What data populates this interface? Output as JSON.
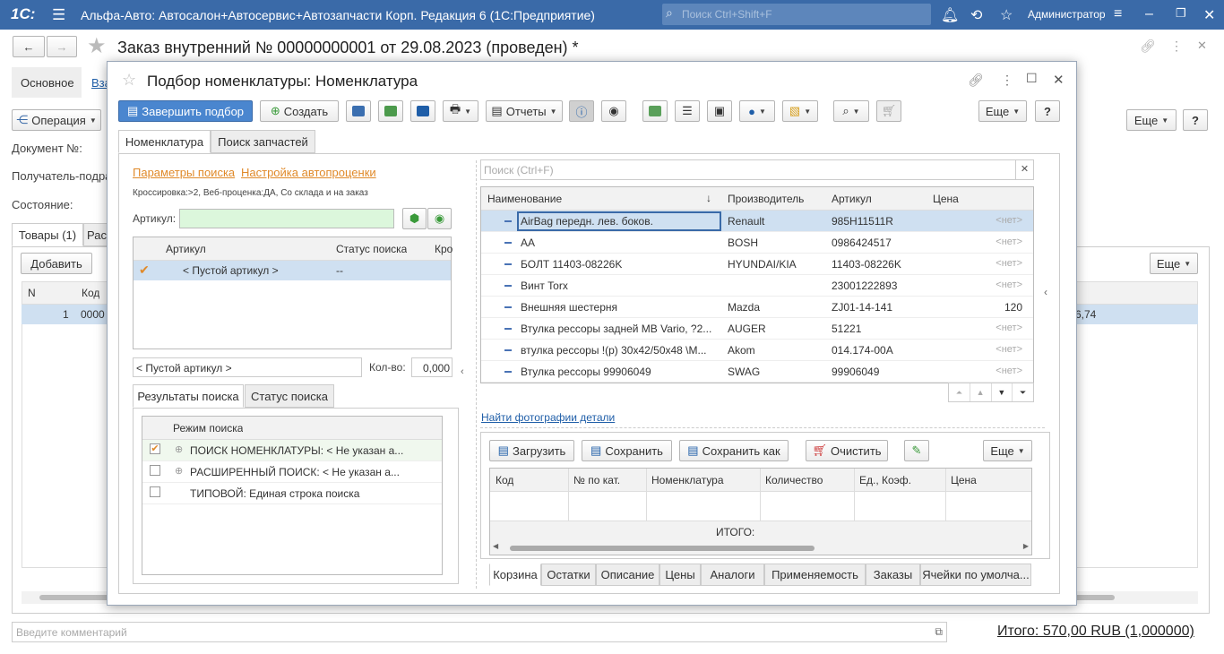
{
  "app": {
    "logo": "1С:",
    "title": "Альфа-Авто: Автосалон+Автосервис+Автозапчасти Корп. Редакция 6  (1С:Предприятие)",
    "search_placeholder": "Поиск Ctrl+Shift+F",
    "user": "Администратор",
    "icons": [
      "bell-icon",
      "history-icon",
      "star-icon",
      "settings-icon",
      "minimize-icon",
      "restore-icon",
      "close-icon"
    ]
  },
  "doc": {
    "title": "Заказ внутренний № 00000000001 от 29.08.2023 (проведен) *",
    "tab_main": "Основное",
    "tab_link": "Вза",
    "operation_btn": "Операция",
    "more_btn": "Еще",
    "help_btn": "?",
    "doc_no_label": "Документ №:",
    "recipient_label": "Получатель-подра",
    "state_label": "Состояние:",
    "goods_tab": "Товары (1)",
    "goods_tab2": "Рас",
    "add_btn": "Добавить",
    "col_n": "N",
    "col_code": "Код",
    "row_n": "1",
    "row_code": "0000",
    "row_tail": "6,74",
    "comment_placeholder": "Введите комментарий",
    "total": "Итого: 570,00 RUB (1,000000)"
  },
  "modal": {
    "title": "Подбор номенклатуры: Номенклатура",
    "finish_btn": "Завершить подбор",
    "create_btn": "Создать",
    "reports_btn": "Отчеты",
    "more_btn": "Еще",
    "help_btn": "?",
    "tab_nom": "Номенклатура",
    "tab_parts": "Поиск запчастей",
    "link_params": "Параметры поиска",
    "link_auto": "Настройка автопроценки",
    "cross_info": "Кроссировка:>2, Веб-проценка:ДА, Со склада и на заказ",
    "article_label": "Артикул:",
    "art_col": "Артикул",
    "status_col": "Статус поиска",
    "cross_col": "Кро",
    "empty_article": "< Пустой артикул >",
    "status_value": "--",
    "article_field": "< Пустой артикул >",
    "qty_label": "Кол-во:",
    "qty_value": "0,000",
    "tab_results": "Результаты поиска",
    "tab_status": "Статус поиска",
    "mode_col": "Режим поиска",
    "modes": [
      {
        "text": "ПОИСК НОМЕНКЛАТУРЫ: < Не указан а...",
        "checked": true
      },
      {
        "text": "РАСШИРЕННЫЙ ПОИСК: < Не указан а...",
        "checked": false
      },
      {
        "text": "ТИПОВОЙ: Единая строка поиска",
        "checked": false
      }
    ],
    "search_placeholder": "Поиск (Ctrl+F)",
    "cols": {
      "name": "Наименование",
      "maker": "Производитель",
      "article": "Артикул",
      "price": "Цена"
    },
    "items": [
      {
        "name": "AirBag передн. лев. боков.",
        "maker": "Renault",
        "article": "985H11511R",
        "price": "<нет>"
      },
      {
        "name": "AA",
        "maker": "BOSH",
        "article": "0986424517",
        "price": "<нет>"
      },
      {
        "name": "БОЛТ 11403-08226K",
        "maker": "HYUNDAI/KIA",
        "article": "11403-08226K",
        "price": "<нет>"
      },
      {
        "name": "Винт Torx",
        "maker": "",
        "article": "23001222893",
        "price": "<нет>"
      },
      {
        "name": "Внешняя шестерня",
        "maker": "Mazda",
        "article": "ZJ01-14-141",
        "price": "120"
      },
      {
        "name": "Втулка рессоры задней MB Vario, ?2...",
        "maker": "AUGER",
        "article": "51221",
        "price": "<нет>"
      },
      {
        "name": "втулка рессоры !(р) 30x42/50x48 \\М...",
        "maker": "Akom",
        "article": "014.174-00A",
        "price": "<нет>"
      },
      {
        "name": "Втулка рессоры 99906049",
        "maker": "SWAG",
        "article": "99906049",
        "price": "<нет>"
      }
    ],
    "photo_link": "Найти фотографии детали",
    "load_btn": "Загрузить",
    "save_btn": "Сохранить",
    "saveas_btn": "Сохранить как",
    "clear_btn": "Очистить",
    "cart_cols": [
      "Код",
      "№ по кат.",
      "Номенклатура",
      "Количество",
      "Ед., Коэф.",
      "Цена"
    ],
    "total_label": "ИТОГО:",
    "bottom_tabs": [
      "Корзина",
      "Остатки",
      "Описание",
      "Цены",
      "Аналоги",
      "Применяемость",
      "Заказы",
      "Ячейки по умолча..."
    ]
  }
}
